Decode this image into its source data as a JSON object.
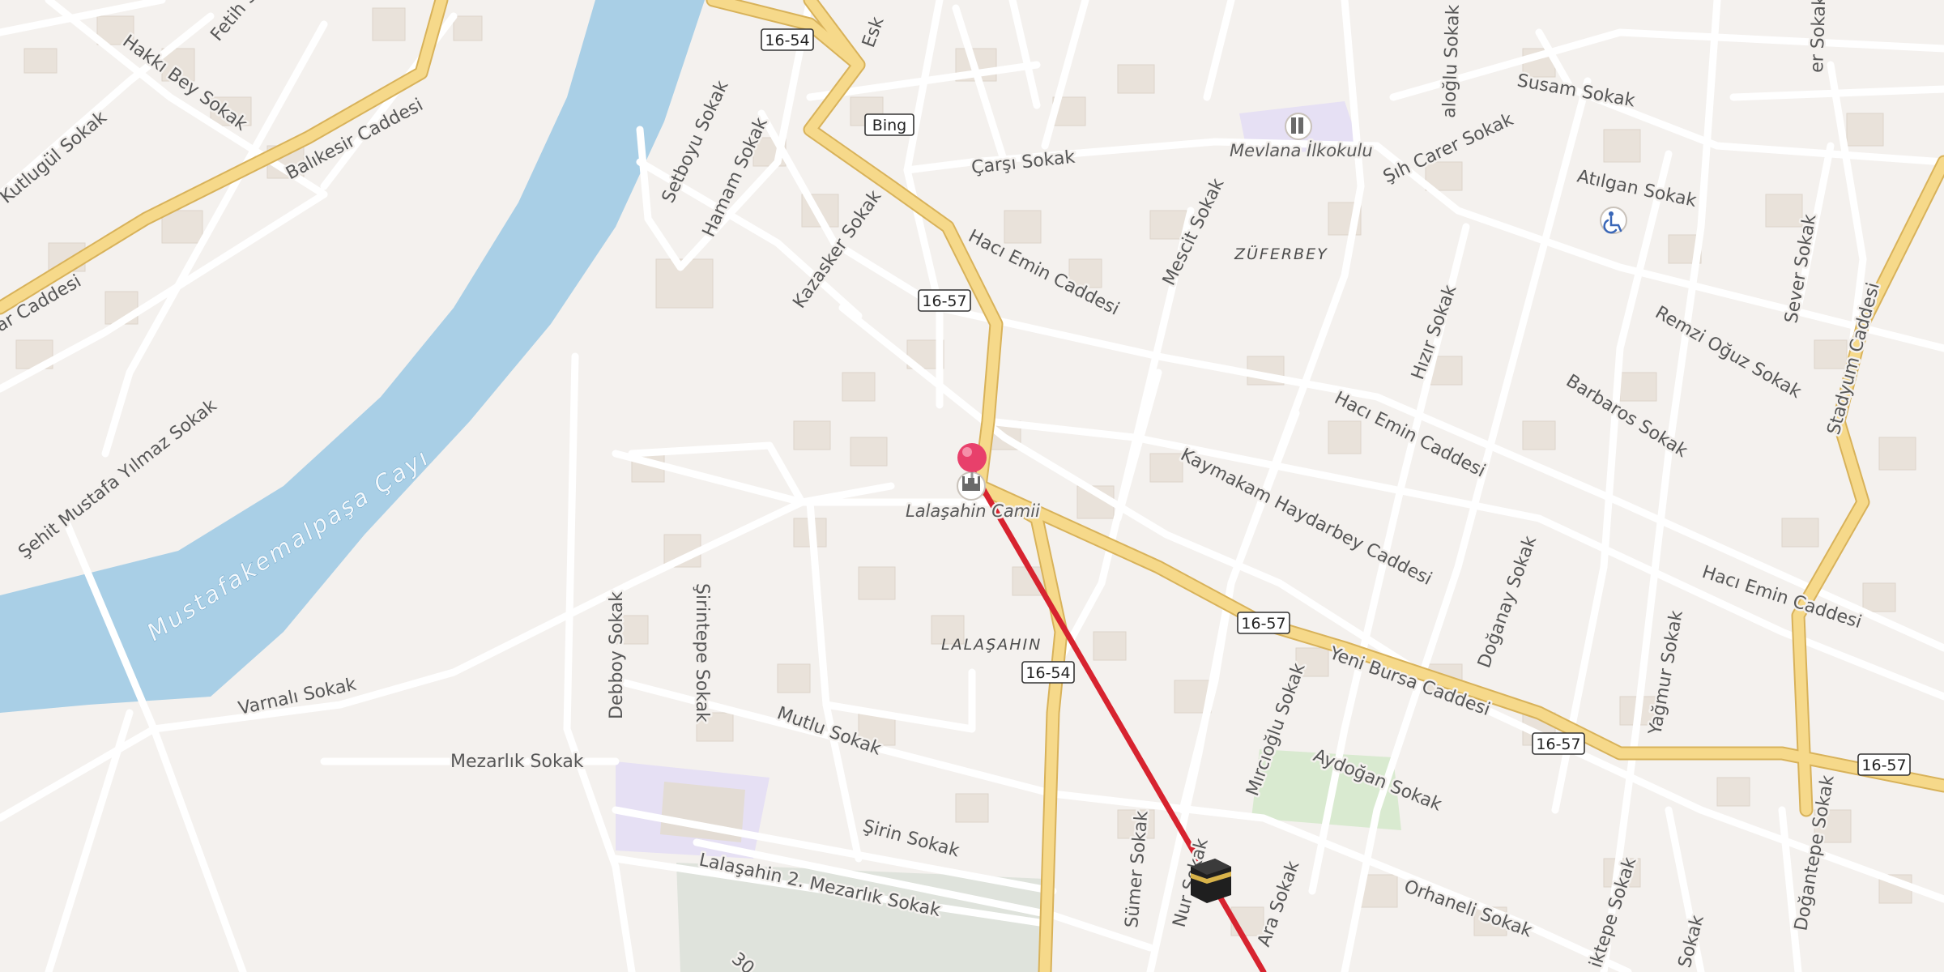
{
  "map": {
    "route_shields": [
      "16-54",
      "16-57",
      "16-57",
      "16-54",
      "16-57",
      "16-57"
    ],
    "bing_label": "Bing",
    "water_label": "Mustafakemalpaşa Çayı",
    "districts": [
      "ZÜFERBEY",
      "LALAŞAHIN"
    ],
    "pois": {
      "mosque": "Lalaşahin Camii",
      "school": "Mevlana İlkokulu"
    },
    "streets": {
      "balikesir": "Balıkesir Caddesi",
      "hakki_bey": "Hakkı Bey Sokak",
      "kutlugul": "Kutlugül Sokak",
      "fetih": "Fetih S",
      "sehit": "Şehit Mustafa Yılmaz Sokak",
      "car": "ar Caddesi",
      "varnali": "Varnalı Sokak",
      "mezarlik": "Mezarlık Sokak",
      "debboy": "Debboy Sokak",
      "sirintepe": "Şirintepe Sokak",
      "mutlu": "Mutlu Sokak",
      "sirin": "Şirin Sokak",
      "lalasahin2": "Lalaşahin 2. Mezarlık Sokak",
      "setboyu": "Setboyu Sokak",
      "hamam": "Hamam Sokak",
      "kazasker": "Kazasker Sokak",
      "carsi": "Çarşı Sokak",
      "haci_emin1": "Hacı Emin Caddesi",
      "haci_emin2": "Hacı Emin Caddesi",
      "haci_emin3": "Hacı Emin Caddesi",
      "mescit": "Mescit Sokak",
      "kaymakam": "Kaymakam Haydarbey Caddesi",
      "yeni_bursa": "Yeni Bursa Caddesi",
      "mircioglu": "Mırcıoğlu Sokak",
      "aydogan": "Aydoğan Sokak",
      "orhaneli": "Orhaneli Sokak",
      "sumer": "Sümer Sokak",
      "nur": "Nur Sokak",
      "ara": "Ara Sokak",
      "susam": "Susam Sokak",
      "sih_carer": "Şıh Carer Sokak",
      "atilgan": "Atılgan Sokak",
      "remzi": "Remzi Oğuz Sokak",
      "barbaros": "Barbaros Sokak",
      "hizir": "Hızır Sokak",
      "doganay": "Doğanay Sokak",
      "yagmur": "Yağmur Sokak",
      "stadyum": "Stadyum Caddesi",
      "sever1": "Sever Sokak",
      "sever2": "er Sokak",
      "doganetepe": "Doğantepe Sokak",
      "aloglu": "aloğlu Sokak",
      "eski": "Esk",
      "iktepe": "iktepe Sokak",
      "sok_bottom": "Sokak",
      "num30": "30"
    },
    "colors": {
      "land": "#f4f1ee",
      "water": "#a9cfe6",
      "major_road": "#f3d27a",
      "route_line": "#d7232f",
      "pin": "#e8406b",
      "park": "#d9ead0",
      "school_area": "#e6e0f4"
    },
    "icons": [
      "map-pin-icon",
      "mosque-icon",
      "kaaba-icon",
      "school-icon",
      "disability-icon"
    ]
  }
}
